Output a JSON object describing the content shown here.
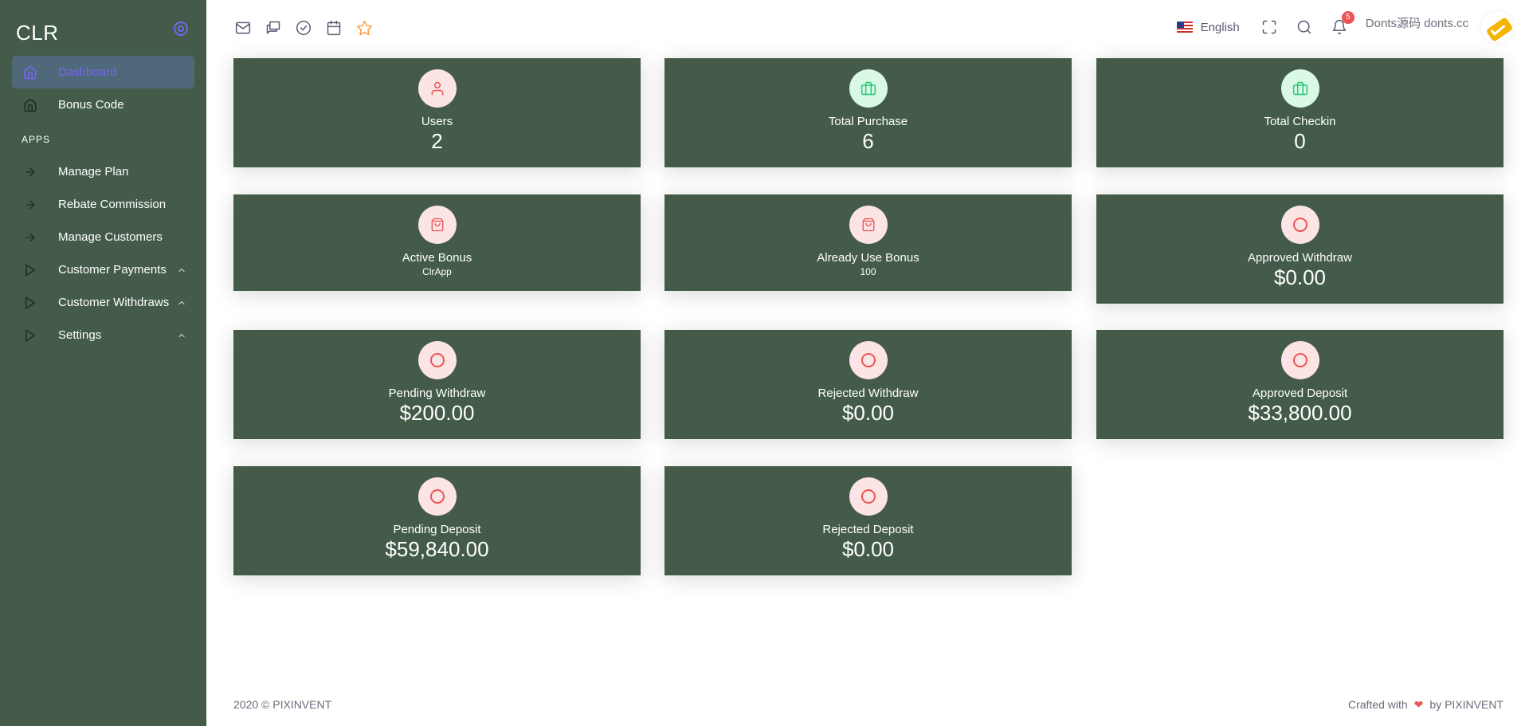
{
  "brand": "CLR",
  "sidebar": {
    "items": [
      {
        "label": "Dashboard",
        "icon": "home-icon",
        "active": true
      },
      {
        "label": "Bonus Code",
        "icon": "home-icon"
      }
    ],
    "section": "APPS",
    "apps": [
      {
        "label": "Manage Plan",
        "icon": "arrow-right-icon"
      },
      {
        "label": "Rebate Commission",
        "icon": "arrow-right-icon"
      },
      {
        "label": "Manage Customers",
        "icon": "arrow-right-icon"
      },
      {
        "label": "Customer Payments",
        "icon": "play-icon",
        "expandable": true
      },
      {
        "label": "Customer Withdraws",
        "icon": "play-icon",
        "expandable": true
      },
      {
        "label": "Settings",
        "icon": "play-icon",
        "expandable": true
      }
    ]
  },
  "topbar": {
    "icons": [
      "mail-icon",
      "chat-icon",
      "check-circle-icon",
      "calendar-icon",
      "star-icon"
    ],
    "language": "English",
    "notifications_count": "5",
    "username": "Donts源码 donts.cc"
  },
  "cards": [
    {
      "label": "Users",
      "value": "2",
      "icon": "user-icon",
      "tone": "pink"
    },
    {
      "label": "Total Purchase",
      "value": "6",
      "icon": "briefcase-icon",
      "tone": "green"
    },
    {
      "label": "Total Checkin",
      "value": "0",
      "icon": "briefcase-icon",
      "tone": "green"
    },
    {
      "label": "Active Bonus",
      "sub": "ClrApp",
      "icon": "shopping-bag-icon",
      "tone": "pink"
    },
    {
      "label": "Already Use Bonus",
      "sub": "100",
      "icon": "shopping-bag-icon",
      "tone": "pink"
    },
    {
      "label": "Approved Withdraw",
      "value": "$0.00",
      "icon": "circle-icon",
      "tone": "pink"
    },
    {
      "label": "Pending Withdraw",
      "value": "$200.00",
      "icon": "circle-icon",
      "tone": "pink"
    },
    {
      "label": "Rejected Withdraw",
      "value": "$0.00",
      "icon": "circle-icon",
      "tone": "pink"
    },
    {
      "label": "Approved Deposit",
      "value": "$33,800.00",
      "icon": "circle-icon",
      "tone": "pink"
    },
    {
      "label": "Pending Deposit",
      "value": "$59,840.00",
      "icon": "circle-icon",
      "tone": "pink"
    },
    {
      "label": "Rejected Deposit",
      "value": "$0.00",
      "icon": "circle-icon",
      "tone": "pink"
    }
  ],
  "footer": {
    "left": "2020 © PIXINVENT",
    "right_prefix": "Crafted with",
    "right_suffix": "by PIXINVENT"
  },
  "colors": {
    "sidebar_bg": "#445b4a",
    "card_bg": "#445b4a",
    "accent": "#7367f0",
    "danger": "#ea5455",
    "success": "#28c76f"
  }
}
